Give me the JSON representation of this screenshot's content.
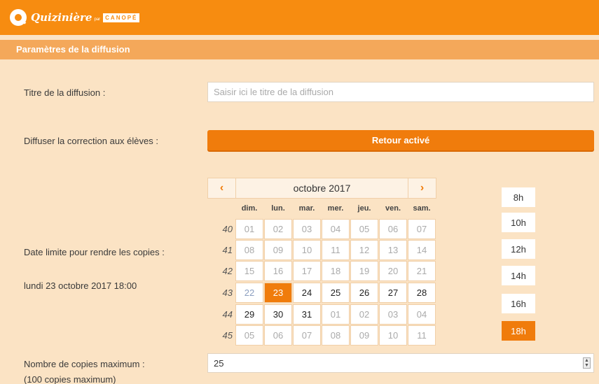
{
  "brand": {
    "name": "Quizinière",
    "by": "par",
    "partner": "CANOPÉ"
  },
  "section": {
    "title": "Paramètres de la diffusion"
  },
  "form": {
    "title_label": "Titre de la diffusion :",
    "title_placeholder": "Saisir ici le titre de la diffusion",
    "title_value": "",
    "correction_label": "Diffuser la correction aux élèves :",
    "correction_button": "Retour activé",
    "deadline_label": "Date limite pour rendre les copies :",
    "deadline_value": "lundi 23 octobre 2017 18:00",
    "copies_label": "Nombre de copies maximum :",
    "copies_hint": "(100 copies maximum)",
    "copies_value": "25"
  },
  "calendar": {
    "month_label": "octobre 2017",
    "prev_icon": "‹",
    "next_icon": "›",
    "day_names": [
      "dim.",
      "lun.",
      "mar.",
      "mer.",
      "jeu.",
      "ven.",
      "sam."
    ],
    "weeks": [
      {
        "num": "40",
        "days": [
          "01",
          "02",
          "03",
          "04",
          "05",
          "06",
          "07"
        ]
      },
      {
        "num": "41",
        "days": [
          "08",
          "09",
          "10",
          "11",
          "12",
          "13",
          "14"
        ]
      },
      {
        "num": "42",
        "days": [
          "15",
          "16",
          "17",
          "18",
          "19",
          "20",
          "21"
        ]
      },
      {
        "num": "43",
        "days": [
          "22",
          "23",
          "24",
          "25",
          "26",
          "27",
          "28"
        ]
      },
      {
        "num": "44",
        "days": [
          "29",
          "30",
          "31",
          "01",
          "02",
          "03",
          "04"
        ]
      },
      {
        "num": "45",
        "days": [
          "05",
          "06",
          "07",
          "08",
          "09",
          "10",
          "11"
        ]
      }
    ]
  },
  "hours": [
    "8h",
    "10h",
    "12h",
    "14h",
    "16h",
    "18h"
  ],
  "colors": {
    "accent": "#f07c0c",
    "background": "#fbe3c4",
    "section": "#f4a85a"
  }
}
